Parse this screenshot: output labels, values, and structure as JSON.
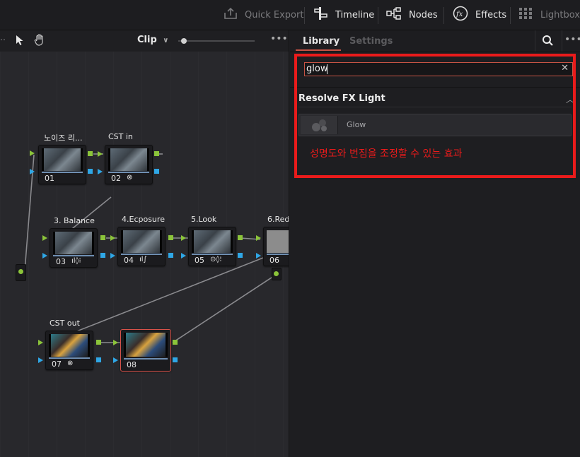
{
  "toolbar": {
    "quick_export": "Quick Export",
    "timeline": "Timeline",
    "nodes": "Nodes",
    "effects": "Effects",
    "lightbox": "Lightbox"
  },
  "node_toolbar": {
    "mode": "Clip"
  },
  "nodes": {
    "n01": {
      "label": "노이즈 리...",
      "num": "01"
    },
    "n02": {
      "label": "CST in",
      "num": "02"
    },
    "n03": {
      "label": "3. Balance",
      "num": "03"
    },
    "n04": {
      "label": "4.Ecposure",
      "num": "04"
    },
    "n05": {
      "label": "5.Look",
      "num": "05"
    },
    "n06": {
      "label": "6.Red",
      "num": "06"
    },
    "n07": {
      "label": "CST out",
      "num": "07"
    },
    "n08": {
      "label": "",
      "num": "08"
    }
  },
  "library": {
    "tab_library": "Library",
    "tab_settings": "Settings",
    "search_value": "glow",
    "section_title": "Resolve FX Light",
    "result_item": "Glow",
    "annotation": "성명도와 번짐을 조정할 수 있는 효과"
  },
  "colors": {
    "accent_red": "#ea1b1b",
    "port_green": "#8bc43a",
    "port_blue": "#2fa7e6",
    "selected_node": "#d9534a"
  }
}
